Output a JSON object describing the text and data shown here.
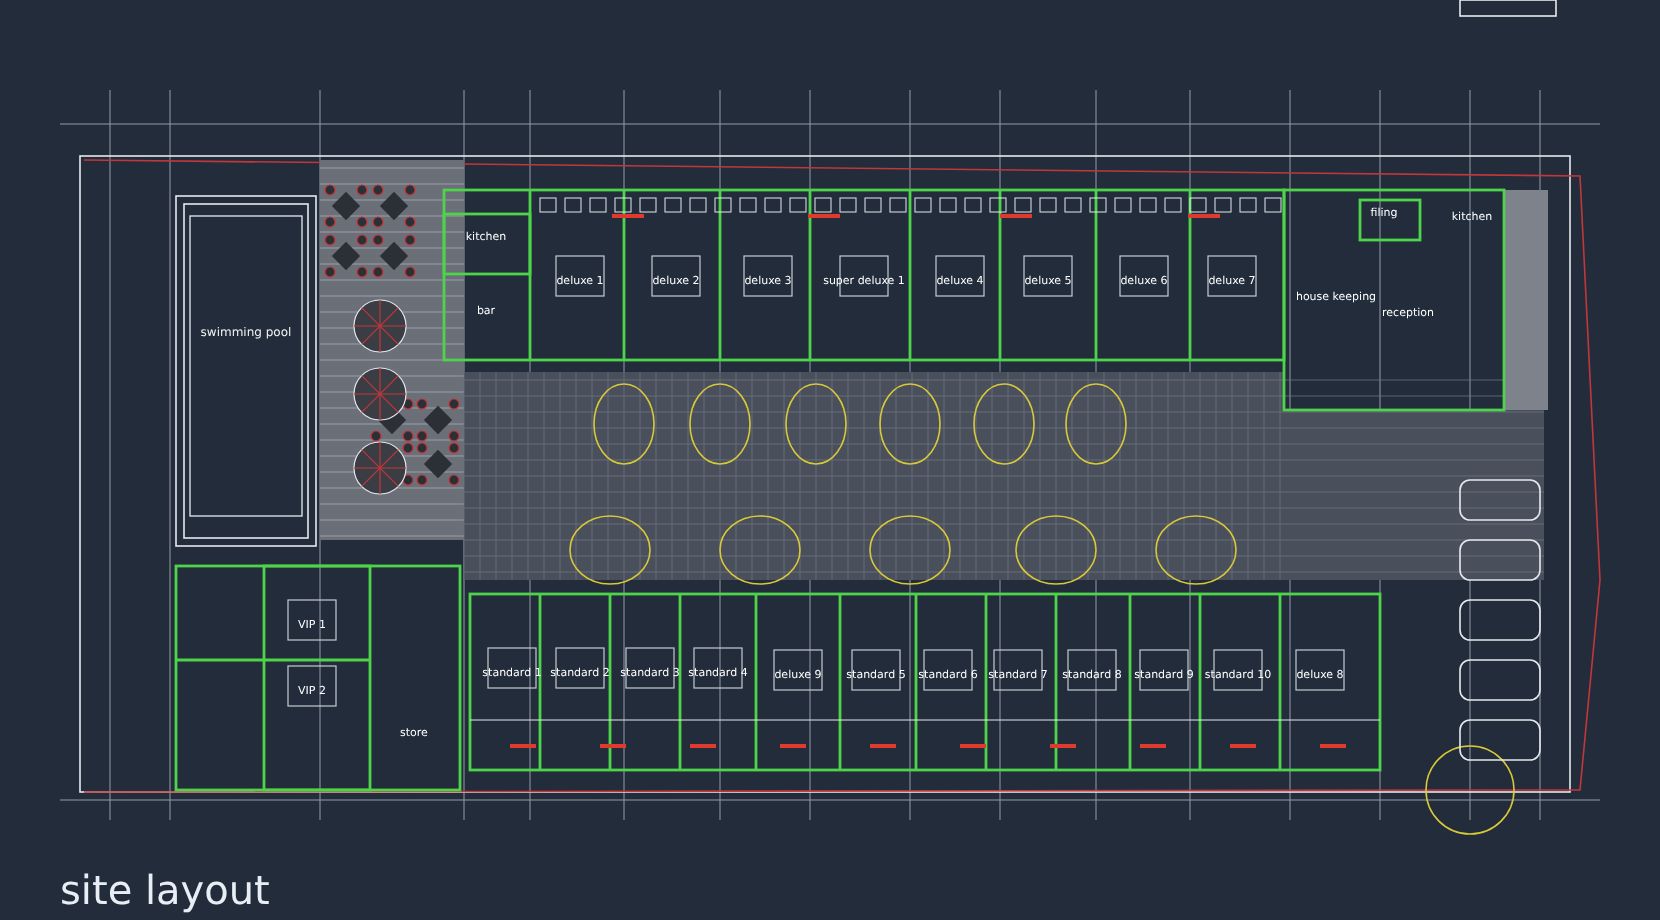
{
  "drawing_title": "site layout",
  "rooms": [
    {
      "label": "swimming pool",
      "kind": "pool"
    },
    {
      "label": "kitchen",
      "kind": "service"
    },
    {
      "label": "bar",
      "kind": "service"
    },
    {
      "label": "deluxe 1",
      "kind": "guest"
    },
    {
      "label": "deluxe 2",
      "kind": "guest"
    },
    {
      "label": "deluxe 3",
      "kind": "guest"
    },
    {
      "label": "super deluxe 1",
      "kind": "guest"
    },
    {
      "label": "deluxe 4",
      "kind": "guest"
    },
    {
      "label": "deluxe 5",
      "kind": "guest"
    },
    {
      "label": "deluxe 6",
      "kind": "guest"
    },
    {
      "label": "deluxe 7",
      "kind": "guest"
    },
    {
      "label": "filing",
      "kind": "service"
    },
    {
      "label": "kitchen",
      "kind": "service"
    },
    {
      "label": "house keeping",
      "kind": "service"
    },
    {
      "label": "reception",
      "kind": "service"
    },
    {
      "label": "VIP 1",
      "kind": "guest"
    },
    {
      "label": "VIP 2",
      "kind": "guest"
    },
    {
      "label": "store",
      "kind": "service"
    },
    {
      "label": "standard 1",
      "kind": "guest"
    },
    {
      "label": "standard 2",
      "kind": "guest"
    },
    {
      "label": "standard 3",
      "kind": "guest"
    },
    {
      "label": "standard 4",
      "kind": "guest"
    },
    {
      "label": "deluxe 9",
      "kind": "guest"
    },
    {
      "label": "standard 5",
      "kind": "guest"
    },
    {
      "label": "standard 6",
      "kind": "guest"
    },
    {
      "label": "standard 7",
      "kind": "guest"
    },
    {
      "label": "standard 8",
      "kind": "guest"
    },
    {
      "label": "standard 9",
      "kind": "guest"
    },
    {
      "label": "standard 10",
      "kind": "guest"
    },
    {
      "label": "deluxe 8",
      "kind": "guest"
    }
  ]
}
